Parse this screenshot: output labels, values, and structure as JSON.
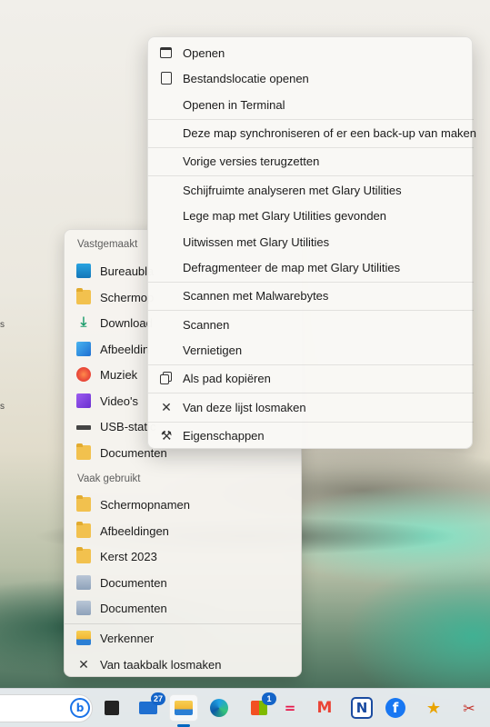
{
  "context_menu": {
    "items": [
      {
        "label": "Openen",
        "icon": "window-icon"
      },
      {
        "label": "Bestandslocatie openen",
        "icon": "open-location-icon"
      },
      {
        "label": "Openen in Terminal",
        "icon": ""
      },
      {
        "label": "Deze map synchroniseren of er een back-up van maken",
        "icon": ""
      },
      {
        "label": "Vorige versies terugzetten",
        "icon": ""
      },
      {
        "label": "Schijfruimte analyseren met Glary Utilities",
        "icon": ""
      },
      {
        "label": "Lege map met Glary Utilities gevonden",
        "icon": ""
      },
      {
        "label": "Uitwissen met Glary Utilities",
        "icon": ""
      },
      {
        "label": "Defragmenteer de map met Glary Utilities",
        "icon": ""
      },
      {
        "label": "Scannen met Malwarebytes",
        "icon": ""
      },
      {
        "label": "Scannen",
        "icon": ""
      },
      {
        "label": "Vernietigen",
        "icon": ""
      },
      {
        "label": "Als pad kopiëren",
        "icon": "copy-path-icon"
      },
      {
        "label": "Van deze lijst losmaken",
        "icon": "unpin-icon"
      },
      {
        "label": "Eigenschappen",
        "icon": "wrench-icon"
      }
    ]
  },
  "jump_list": {
    "pinned_header": "Vastgemaakt",
    "pinned": [
      {
        "label": "Bureaubla",
        "icon": "desktop-icon"
      },
      {
        "label": "Schermop",
        "icon": "folder-icon"
      },
      {
        "label": "Download",
        "icon": "download-icon"
      },
      {
        "label": "Afbeeldin",
        "icon": "pictures-icon"
      },
      {
        "label": "Muziek",
        "icon": "music-icon"
      },
      {
        "label": "Video's",
        "icon": "videos-icon"
      },
      {
        "label": "USB-static",
        "icon": "usb-drive-icon"
      },
      {
        "label": "Documenten",
        "icon": "folder-icon"
      }
    ],
    "frequent_header": "Vaak gebruikt",
    "frequent": [
      {
        "label": "Schermopnamen",
        "icon": "folder-icon"
      },
      {
        "label": "Afbeeldingen",
        "icon": "folder-icon"
      },
      {
        "label": "Kerst 2023",
        "icon": "folder-icon"
      },
      {
        "label": "Documenten",
        "icon": "documents-icon"
      },
      {
        "label": "Documenten",
        "icon": "documents-icon"
      }
    ],
    "footer": [
      {
        "label": "Verkenner",
        "icon": "file-explorer-icon"
      },
      {
        "label": "Van taakbalk losmaken",
        "icon": "unpin-icon"
      }
    ]
  },
  "taskbar": {
    "mail_badge": "27",
    "store_badge": "1",
    "icons": [
      "bing-icon",
      "task-view-icon",
      "mail-icon",
      "file-explorer-icon",
      "edge-icon",
      "store-icon",
      "app-icon",
      "gmail-icon",
      "newspaper-icon",
      "facebook-icon",
      "star-app-icon",
      "snip-icon"
    ]
  }
}
